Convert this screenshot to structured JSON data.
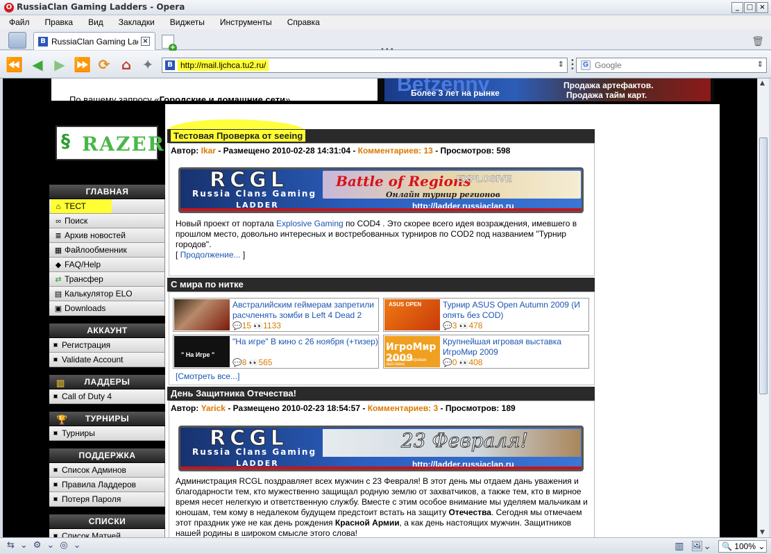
{
  "window": {
    "title": "RussiaClan Gaming Ladders - Opera",
    "controls": [
      "_",
      "□",
      "×"
    ]
  },
  "menu": [
    "Файл",
    "Правка",
    "Вид",
    "Закладки",
    "Виджеты",
    "Инструменты",
    "Справка"
  ],
  "tab": {
    "title": "RussiaClan Gaming Ladd..."
  },
  "address": {
    "url": "http://mail.ljchca.tu2.ru/"
  },
  "search": {
    "placeholder": "Google"
  },
  "statusbar": {
    "zoom": "100%"
  },
  "ads": {
    "left_text_prefix": "По вашему запросу «",
    "left_text_bold": "Городские и домашние сети",
    "left_text_suffix": "»",
    "right_big": "Betzenny",
    "right_small": "Более 3 лет на рынке",
    "right_line1": "Продажа артефактов.",
    "right_line2": "Продажа тайм карт."
  },
  "logo": {
    "name": "RAZER"
  },
  "sidebar": {
    "sections": [
      {
        "title": "ГЛАВНАЯ",
        "items": [
          {
            "label": "ТЕСТ",
            "icon": "home-icon"
          },
          {
            "label": "Поиск",
            "icon": "binoculars-icon"
          },
          {
            "label": "Архив новостей",
            "icon": "archive-icon"
          },
          {
            "label": "Файлообменник",
            "icon": "files-icon"
          },
          {
            "label": "FAQ/Help",
            "icon": "help-icon"
          },
          {
            "label": "Трансфер",
            "icon": "transfer-icon"
          },
          {
            "label": "Калькулятор ELO",
            "icon": "calculator-icon"
          },
          {
            "label": "Downloads",
            "icon": "download-icon"
          }
        ]
      },
      {
        "title": "АККАУНТ",
        "items": [
          {
            "label": "Регистрация"
          },
          {
            "label": "Validate Account"
          }
        ]
      },
      {
        "title": "ЛАДДЕРЫ",
        "items": [
          {
            "label": "Call of Duty 4"
          }
        ]
      },
      {
        "title": "ТУРНИРЫ",
        "items": [
          {
            "label": "Турниры"
          }
        ]
      },
      {
        "title": "ПОДДЕРЖКА",
        "items": [
          {
            "label": "Список Админов"
          },
          {
            "label": "Правила Ладдеров"
          },
          {
            "label": "Потеря Пароля"
          }
        ]
      },
      {
        "title": "СПИСКИ",
        "items": [
          {
            "label": "Список Матчей"
          }
        ]
      }
    ]
  },
  "posts": [
    {
      "title": "Тестовая Проверка от seeing",
      "author_label": "Автор:",
      "author": "Ikar",
      "posted": "- Размещено 2010-02-28 14:31:04 -",
      "comments": "Комментариев: 13",
      "views": "- Просмотров: 598",
      "banner": {
        "logo": "RCGL",
        "sub": "Russia Clans Gaming",
        "ladder": "LADDER",
        "url": "http://ladder.russiaclan.ru",
        "headline": "Battle of Regions",
        "subline": "Онлайн турнир регионов",
        "brand": "EXPLOSIVE"
      },
      "body_1": "Новый проект от портала ",
      "body_link": "Explosive Gaming",
      "body_2": " по COD4 . Это скорее всего идея возраждения, имевшего в прошлом место, довольно интересных и востребованных турниров по COD2  под названием \"Турнир городов\".",
      "more_open": "[ ",
      "more": "Продолжение...",
      "more_close": " ]"
    },
    {
      "title": "День Защитника Отечества!",
      "author_label": "Автор:",
      "author": "Yarick",
      "posted": "- Размещено 2010-02-23 18:54:57 -",
      "comments": "Комментариев: 3",
      "views": "- Просмотров: 189",
      "banner": {
        "logo": "RCGL",
        "sub": "Russia Clans Gaming",
        "ladder": "LADDER",
        "url": "http://ladder.russiaclan.ru",
        "headline": "23 Февраля!"
      },
      "body_1": "Администрация RCGL поздравляет всех мужчин с 23 Февраля! В этот день мы отдаем дань уважения и благодарности тем, кто мужественно защищал родную землю от захватчиков, а также тем, кто в мирное время несет нелегкую и ответственную службу. Вместе с этим особое внимание мы уделяем мальчикам и юношам, тем кому в недалеком будущем предстоит встать на защиту ",
      "body_b1": "Отечества",
      "body_2": ". Сегодня мы отмечаем этот праздник уже не как день рождения ",
      "body_b2": "Красной Армии",
      "body_3": ", а как день настоящих мужчин. Защитников нашей родины в широком смысле этого слова!"
    }
  ],
  "world": {
    "title": "С мира по нитке",
    "items": [
      {
        "title": "Австралийским геймерам запретили расчленять зомби в Left 4 Dead 2",
        "comments": "15",
        "views": "1133"
      },
      {
        "title": "Турнир ASUS Open Autumn 2009 (И опять без COD)",
        "comments": "3",
        "views": "478"
      },
      {
        "title": "\"На игре\" В кино с 26 ноября (+тизер)",
        "comments": "8",
        "views": "565"
      },
      {
        "title": "Крупнейшая игровая выставка ИгроМир 2009",
        "comments": "0",
        "views": "408"
      }
    ],
    "thumb_labels": {
      "asus": "ASUS OPEN",
      "naigre": "\" На Игре \"",
      "igromir": "ИгроМир 2009",
      "igromir_sub": "крупнейшая игровая выставка"
    },
    "see_all": "[Смотреть все...]"
  }
}
